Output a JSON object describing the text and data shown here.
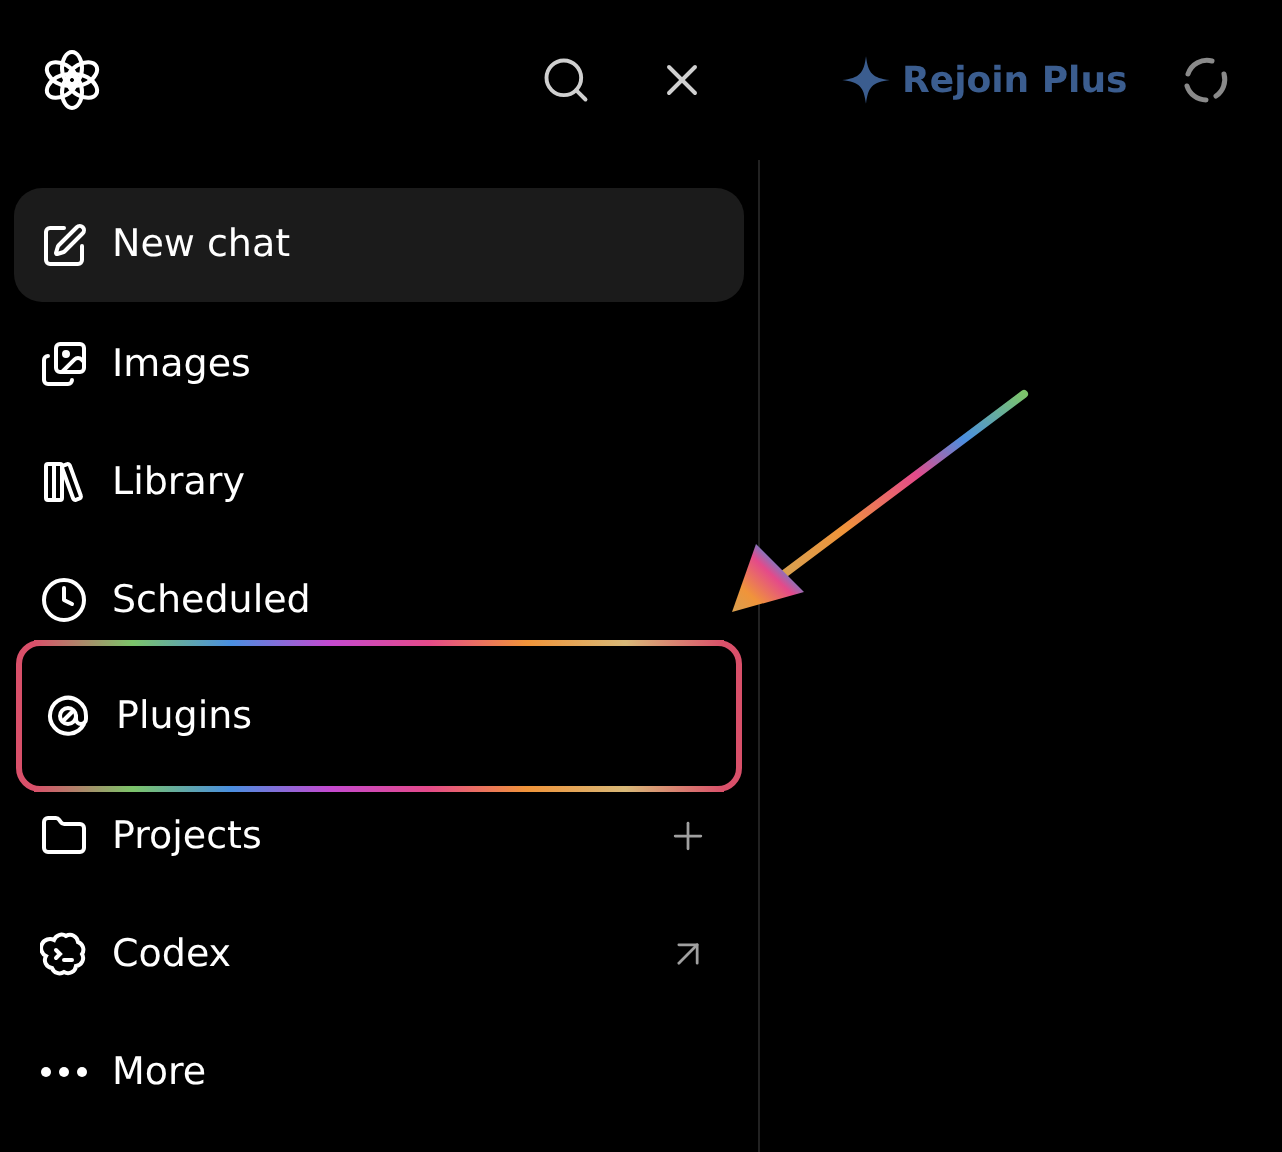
{
  "header": {
    "upgrade_label": "Rejoin Plus"
  },
  "sidebar": {
    "items": [
      {
        "label": "New chat",
        "selected": true,
        "highlighted": false
      },
      {
        "label": "Images",
        "selected": false,
        "highlighted": false
      },
      {
        "label": "Library",
        "selected": false,
        "highlighted": false
      },
      {
        "label": "Scheduled",
        "selected": false,
        "highlighted": false
      },
      {
        "label": "Plugins",
        "selected": false,
        "highlighted": true
      },
      {
        "label": "Projects",
        "selected": false,
        "highlighted": false
      },
      {
        "label": "Codex",
        "selected": false,
        "highlighted": false
      },
      {
        "label": "More",
        "selected": false,
        "highlighted": false
      }
    ]
  }
}
